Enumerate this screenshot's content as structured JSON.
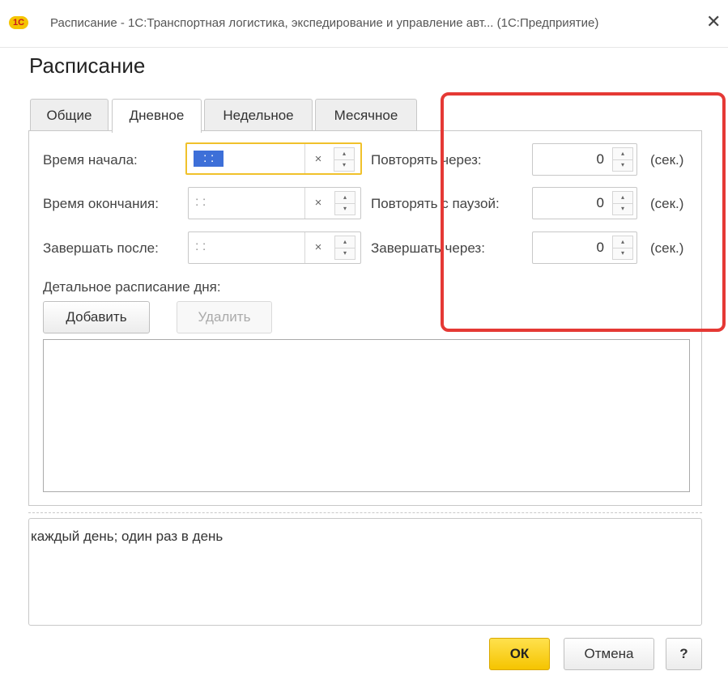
{
  "window": {
    "logo_text": "1С",
    "title": "Расписание - 1С:Транспортная логистика, экспедирование и управление авт... (1С:Предприятие)",
    "close_label": "✕"
  },
  "form_title": "Расписание",
  "tabs": [
    {
      "label": "Общие",
      "active": false
    },
    {
      "label": "Дневное",
      "active": true
    },
    {
      "label": "Недельное",
      "active": false
    },
    {
      "label": "Месячное",
      "active": false
    }
  ],
  "daily": {
    "start_time": {
      "label": "Время начала:",
      "value": " :  : "
    },
    "end_time": {
      "label": "Время окончания:",
      "value": " :  : "
    },
    "finish_after": {
      "label": "Завершать после:",
      "value": " :  : "
    },
    "repeat_every": {
      "label": "Повторять через:",
      "value": "0",
      "unit": "(сек.)"
    },
    "repeat_pause": {
      "label": "Повторять с паузой:",
      "value": "0",
      "unit": "(сек.)"
    },
    "finish_in": {
      "label": "Завершать через:",
      "value": "0",
      "unit": "(сек.)"
    },
    "clear_symbol": "×",
    "spin_up": "▴",
    "spin_down": "▾",
    "detail_label": "Детальное расписание дня:",
    "add_button": "Добавить",
    "delete_button": "Удалить"
  },
  "summary_text": "каждый день; один раз в день",
  "footer": {
    "ok": "ОК",
    "cancel": "Отмена",
    "help": "?"
  },
  "colors": {
    "highlight_box": "#e53935",
    "ok_button": "#f5c400",
    "focus_border": "#f0c12b",
    "selection": "#3d6fd8"
  }
}
